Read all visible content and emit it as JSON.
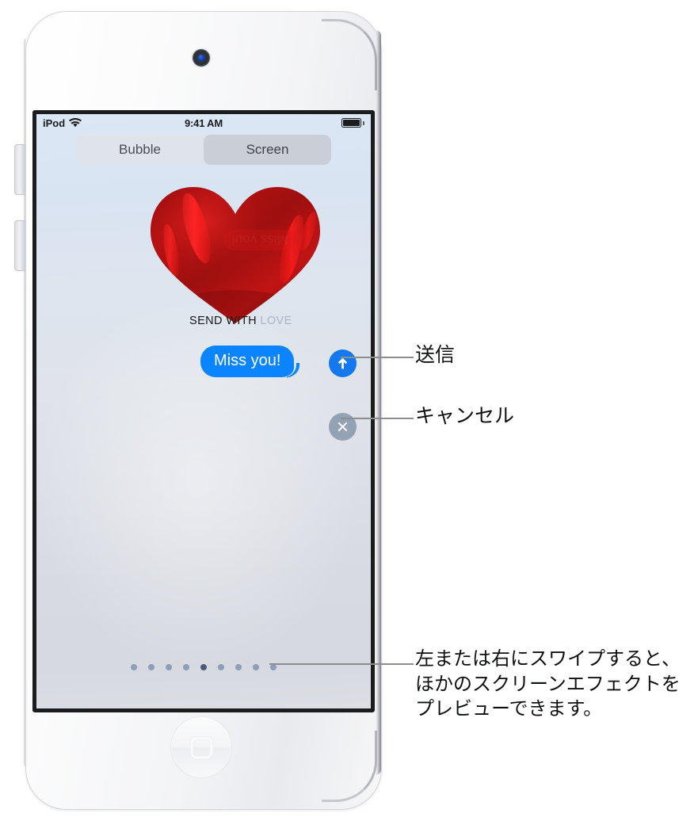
{
  "device": {
    "name": "iPod touch",
    "camera_icon": "front-camera-icon",
    "home_button_icon": "home-button-icon"
  },
  "status_bar": {
    "carrier": "iPod",
    "wifi_icon": "wifi-icon",
    "time": "9:41 AM",
    "battery_icon": "battery-full-icon"
  },
  "segmented_control": {
    "options": [
      {
        "label": "Bubble",
        "selected": false
      },
      {
        "label": "Screen",
        "selected": true
      }
    ]
  },
  "effect": {
    "name": "SEND WITH LOVE",
    "name_part_dark": "SEND WITH ",
    "name_part_light": "LOVE",
    "balloon_icon": "heart-balloon-icon",
    "balloon_color": "#b01010",
    "balloon_highlight_color": "#ff1a1a"
  },
  "message": {
    "bubble_text": "Miss you!",
    "bubble_color": "#0b84ff",
    "bubble_text_color": "#ffffff"
  },
  "actions": {
    "send": {
      "icon": "send-arrow-up-icon",
      "color": "#1479f0"
    },
    "cancel": {
      "icon": "cancel-x-icon",
      "color": "#93a2b5"
    }
  },
  "page_dots": {
    "total": 9,
    "active_index": 4,
    "dot_color": "#8e9dba",
    "active_dot_color": "#4a5a75"
  },
  "callouts": {
    "send": "送信",
    "cancel": "キャンセル",
    "swipe": "左または右にスワイプすると、ほかのスクリーンエフェクトをプレビューできます。"
  }
}
